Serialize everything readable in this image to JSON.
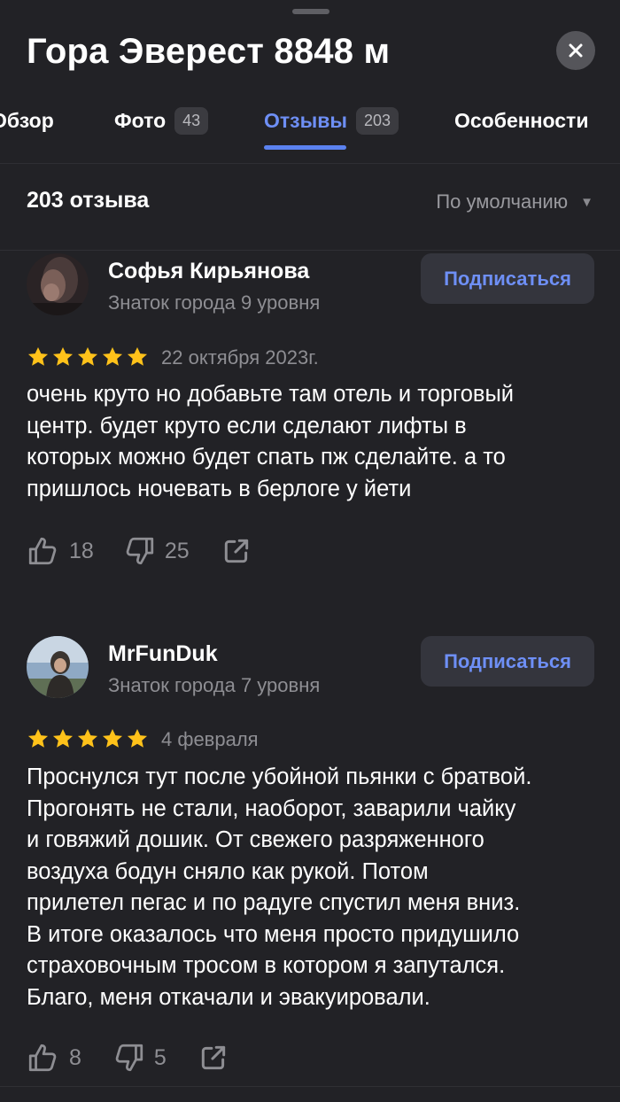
{
  "header": {
    "title": "Гора Эверест 8848 м"
  },
  "tabs": [
    {
      "label": "Обзор",
      "count": ""
    },
    {
      "label": "Фото",
      "count": "43"
    },
    {
      "label": "Отзывы",
      "count": "203",
      "active": true
    },
    {
      "label": "Особенности",
      "count": ""
    }
  ],
  "reviews_header": {
    "count_label": "203 отзыва",
    "sort_label": "По умолчанию"
  },
  "reviews": [
    {
      "author": "Софья Кирьянова",
      "level": "Знаток города 9 уровня",
      "subscribe_label": "Подписаться",
      "rating": 5,
      "date": "22 октября 2023г.",
      "text_lines": [
        "очень круто но добавьте там отель и торговый",
        "центр. будет круто если сделают лифты в",
        "которых можно будет спать пж сделайте. а то",
        "пришлось ночевать в берлоге у йети"
      ],
      "likes": "18",
      "dislikes": "25"
    },
    {
      "author": "MrFunDuk",
      "level": "Знаток города 7 уровня",
      "subscribe_label": "Подписаться",
      "rating": 5,
      "date": "4 февраля",
      "text_lines": [
        "Проснулся тут после убойной пьянки с братвой.",
        "Прогонять не стали, наоборот, заварили чайку",
        "и говяжий дошик. От свежего разряженного",
        "воздуха бодун сняло как рукой. Потом",
        "прилетел пегас и по радуге спустил меня вниз.",
        "В итоге оказалось что меня просто придушило",
        "страховочным тросом в котором я запутался.",
        "Благо, меня откачали и эвакуировали."
      ],
      "likes": "8",
      "dislikes": "5"
    }
  ],
  "colors": {
    "background": "#222226",
    "accent": "#6e8ff5",
    "star": "#ffc21a",
    "muted": "#8e8e93"
  }
}
